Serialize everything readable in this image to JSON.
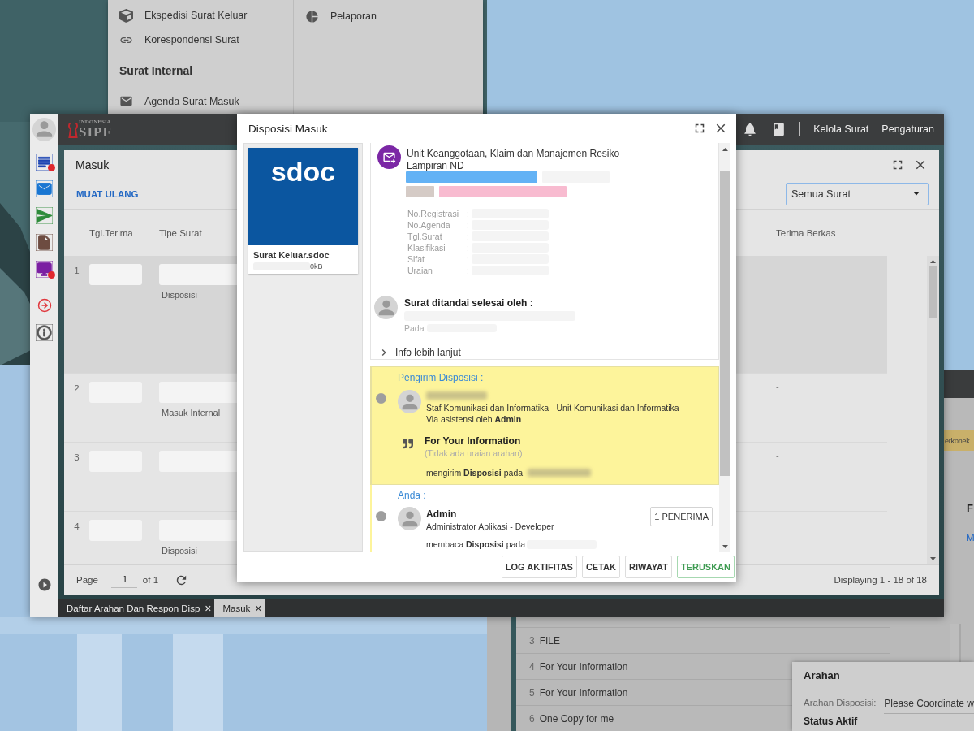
{
  "menu_panel": {
    "columns": [
      {
        "items": [
          {
            "kind": "item",
            "label": "Ekspedisi Surat Keluar"
          },
          {
            "kind": "item",
            "label": "Korespondensi Surat"
          },
          {
            "kind": "heading",
            "label": "Surat Internal"
          },
          {
            "kind": "item",
            "label": "Agenda Surat Masuk"
          }
        ]
      },
      {
        "items": [
          {
            "kind": "item",
            "label": "Pelaporan"
          }
        ]
      }
    ]
  },
  "background_window": {
    "notice": "erkonek",
    "letters": [
      "F",
      "M"
    ],
    "rows": [
      {
        "number": "3",
        "label": "FILE"
      },
      {
        "number": "4",
        "label": "For Your Information"
      },
      {
        "number": "5",
        "label": "For Your Information"
      },
      {
        "number": "6",
        "label": "One Copy for me"
      }
    ],
    "arahan": {
      "title": "Arahan",
      "field_label": "Arahan Disposisi:",
      "field_value": "Please Coordinate w",
      "status_title": "Status Aktif"
    }
  },
  "app": {
    "sidebar": {
      "items": [
        {
          "notification": true
        },
        {
          "notification": false
        },
        {
          "notification": false
        },
        {
          "notification": false
        },
        {
          "notification": true
        },
        {
          "notification": false
        },
        {
          "notification": false
        }
      ]
    },
    "topbar": {
      "logo": {
        "top": "INDONESIA",
        "main": "SIPF"
      },
      "links": [
        "Kelola Surat",
        "Pengaturan"
      ]
    },
    "window": {
      "title": "Masuk",
      "reload": "MUAT ULANG",
      "filter": "Semua Surat",
      "columns": [
        "Tgl.Terima",
        "Tipe Surat",
        "Terima Berkas"
      ],
      "rows": [
        {
          "number": "1",
          "type": "Disposisi",
          "received": "-",
          "selected": true
        },
        {
          "number": "2",
          "type": "Masuk Internal",
          "received": "-",
          "selected": false
        },
        {
          "number": "3",
          "received": "-",
          "selected": false
        },
        {
          "number": "4",
          "type": "Disposisi",
          "received": "-",
          "selected": false
        }
      ],
      "pager": {
        "label": "Page",
        "page": "1",
        "of": "of 1",
        "display": "Displaying 1 - 18 of 18"
      }
    },
    "taskbar": [
      {
        "label": "Daftar Arahan Dan Respon Disp",
        "close": "×",
        "selected": false
      },
      {
        "label": "Masuk",
        "close": "×",
        "selected": true
      }
    ]
  },
  "dialog": {
    "title": "Disposisi Masuk",
    "attachment": {
      "thumb_text": "sdoc",
      "name": "Surat Keluar.sdoc",
      "size": "0kB"
    },
    "letter": {
      "unit": "Unit Keanggotaan, Klaim dan Manajemen Resiko",
      "subtitle": "Lampiran ND",
      "fields": [
        {
          "label": "No.Registrasi",
          "separator": ":"
        },
        {
          "label": "No.Agenda",
          "separator": ":"
        },
        {
          "label": "Tgl.Surat",
          "separator": ":"
        },
        {
          "label": "Klasifikasi",
          "separator": ":"
        },
        {
          "label": "Sifat",
          "separator": ":"
        },
        {
          "label": "Uraian",
          "separator": ":"
        }
      ]
    },
    "completed": {
      "title": "Surat ditandai selesai oleh :",
      "on_label": "Pada"
    },
    "more_info": "Info lebih lanjut",
    "timeline": [
      {
        "heading": "Pengirim Disposisi :",
        "highlighted": true,
        "position": "Staf Komunikasi dan Informatika - Unit Komunikasi dan Informatika",
        "via": "Via asistensi oleh **Admin**",
        "instruction": "For Your Information",
        "note": "(Tidak ada uraian arahan)",
        "action": "mengirim **Disposisi** pada"
      },
      {
        "heading": "Anda :",
        "highlighted": false,
        "name": "Admin",
        "position": "Administrator Aplikasi - Developer",
        "recipients": "1 PENERIMA",
        "action": "membaca **Disposisi** pada"
      }
    ],
    "buttons": [
      {
        "label": "LOG AKTIFITAS",
        "primary": false
      },
      {
        "label": "CETAK",
        "primary": false
      },
      {
        "label": "RIWAYAT",
        "primary": false
      },
      {
        "label": "TERUSKAN",
        "primary": true
      }
    ]
  }
}
